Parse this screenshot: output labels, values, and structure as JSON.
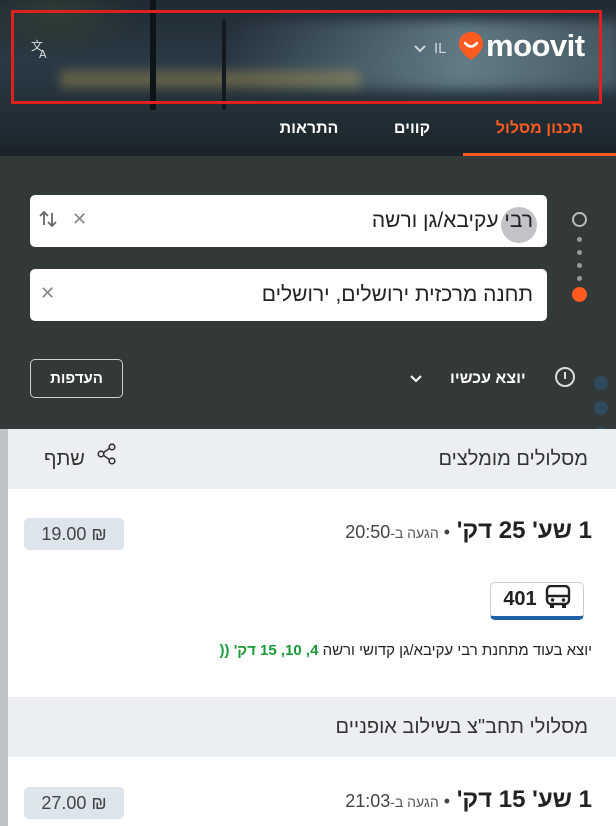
{
  "header": {
    "locale": "IL",
    "brand": "moovit",
    "translate_icon": "translate-icon",
    "brand_color": "#ff5a1f"
  },
  "tabs": [
    {
      "label": "תכנון מסלול",
      "active": true
    },
    {
      "label": "קווים",
      "active": false
    },
    {
      "label": "התראות",
      "active": false
    }
  ],
  "planner": {
    "from": "רבי עקיבא/גן ורשה",
    "to": "תחנה מרכזית ירושלים, ירושלים",
    "departure": "יוצא עכשיו",
    "preferences": "העדפות"
  },
  "recommended": {
    "title": "מסלולים מומלצים",
    "share": "שתף"
  },
  "route1": {
    "duration": "1 שע' 25 דק'",
    "arrival_prefix": "הגעה ב-",
    "arrival_time": "20:50",
    "price": "19.00 ₪",
    "line": "401",
    "leaves_text": "יוצא בעוד מתחנת רבי עקיבא/גן קדושי ורשה",
    "leaves_times": "4, 10, 15 דק'"
  },
  "bike_section": {
    "title": "מסלולי תחב\"צ בשילוב אופניים"
  },
  "route2": {
    "duration": "1 שע' 15 דק'",
    "arrival_prefix": "הגעה ב-",
    "arrival_time": "21:03",
    "price": "27.00 ₪"
  }
}
